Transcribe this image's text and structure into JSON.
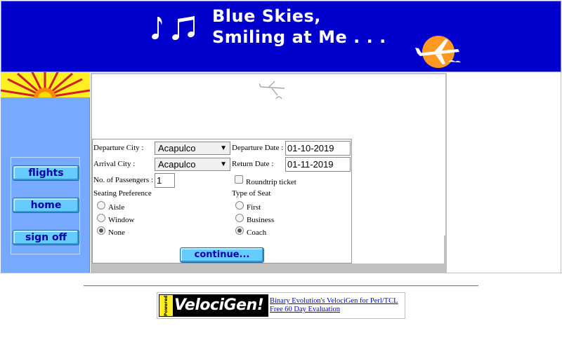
{
  "banner": {
    "title_line1": "Blue Skies,",
    "title_line2": "Smiling at Me . . ."
  },
  "sidebar": {
    "nav": [
      {
        "label": "flights"
      },
      {
        "label": "home"
      },
      {
        "label": "sign off"
      }
    ]
  },
  "form": {
    "departure_city_label": "Departure City :",
    "departure_city_value": "Acapulco",
    "departure_date_label": "Departure Date :",
    "departure_date_value": "01-10-2019",
    "arrival_city_label": "Arrival City :",
    "arrival_city_value": "Acapulco",
    "return_date_label": "Return Date :",
    "return_date_value": "01-11-2019",
    "passengers_label": "No. of Passengers :",
    "passengers_value": "1",
    "roundtrip_label": "Roundtrip ticket",
    "seating_pref_label": "Seating Preference",
    "seating_options": [
      "Aisle",
      "Window",
      "None"
    ],
    "seating_selected": "None",
    "seat_type_label": "Type of Seat",
    "seat_type_options": [
      "First",
      "Business",
      "Coach"
    ],
    "seat_type_selected": "Coach",
    "continue_label": "continue..."
  },
  "footer": {
    "logo_powered": "Powered By",
    "logo_text": "VelociGen!",
    "link1": "Binary Evolution's VelociGen for Perl/TCL",
    "link2": "Free 60 Day Evaluation"
  },
  "colors": {
    "banner_bg": "#0000cc",
    "sidebar_bg": "#77aaff",
    "button_bg": "#66ccff",
    "button_text": "#0000aa"
  }
}
